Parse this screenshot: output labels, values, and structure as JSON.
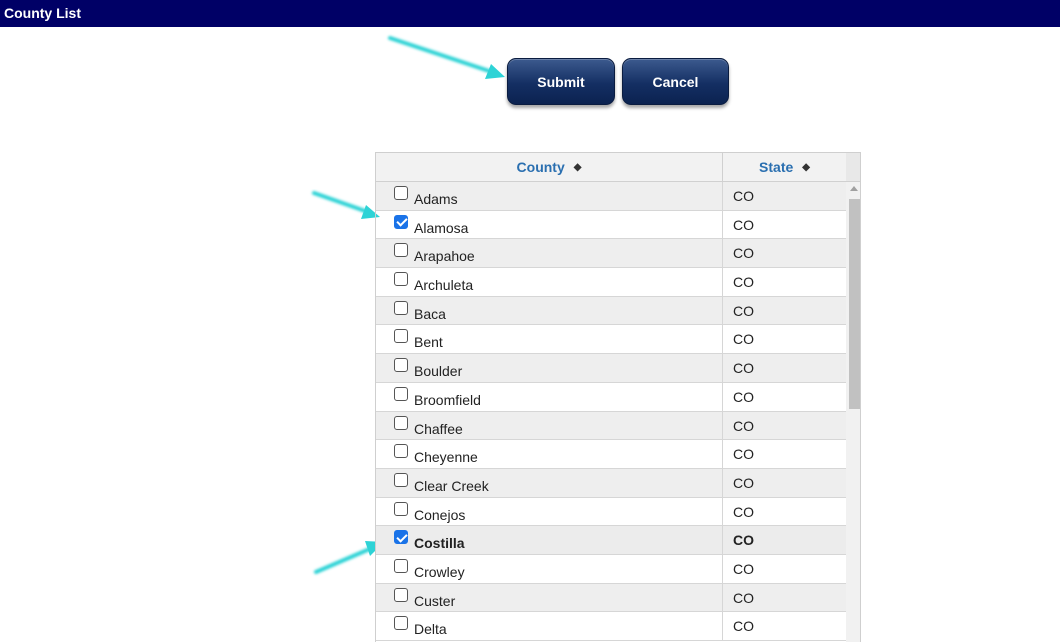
{
  "window": {
    "title": "County List"
  },
  "toolbar": {
    "submit_label": "Submit",
    "cancel_label": "Cancel"
  },
  "grid": {
    "columns": [
      {
        "label": "County",
        "sort_icon": "sort-icon"
      },
      {
        "label": "State",
        "sort_icon": "sort-icon"
      }
    ],
    "rows": [
      {
        "county": "Adams",
        "state": "CO",
        "checked": false
      },
      {
        "county": "Alamosa",
        "state": "CO",
        "checked": true
      },
      {
        "county": "Arapahoe",
        "state": "CO",
        "checked": false
      },
      {
        "county": "Archuleta",
        "state": "CO",
        "checked": false
      },
      {
        "county": "Baca",
        "state": "CO",
        "checked": false
      },
      {
        "county": "Bent",
        "state": "CO",
        "checked": false
      },
      {
        "county": "Boulder",
        "state": "CO",
        "checked": false
      },
      {
        "county": "Broomfield",
        "state": "CO",
        "checked": false
      },
      {
        "county": "Chaffee",
        "state": "CO",
        "checked": false
      },
      {
        "county": "Cheyenne",
        "state": "CO",
        "checked": false
      },
      {
        "county": "Clear Creek",
        "state": "CO",
        "checked": false
      },
      {
        "county": "Conejos",
        "state": "CO",
        "checked": false
      },
      {
        "county": "Costilla",
        "state": "CO",
        "checked": true,
        "highlighted": true
      },
      {
        "county": "Crowley",
        "state": "CO",
        "checked": false
      },
      {
        "county": "Custer",
        "state": "CO",
        "checked": false
      },
      {
        "county": "Delta",
        "state": "CO",
        "checked": false
      }
    ]
  },
  "colors": {
    "titlebar": "#000066",
    "button": "#142f63",
    "header_text": "#2a6fb0",
    "checkbox_checked": "#1a73e8",
    "annotation_arrow": "#2ed3d6"
  }
}
